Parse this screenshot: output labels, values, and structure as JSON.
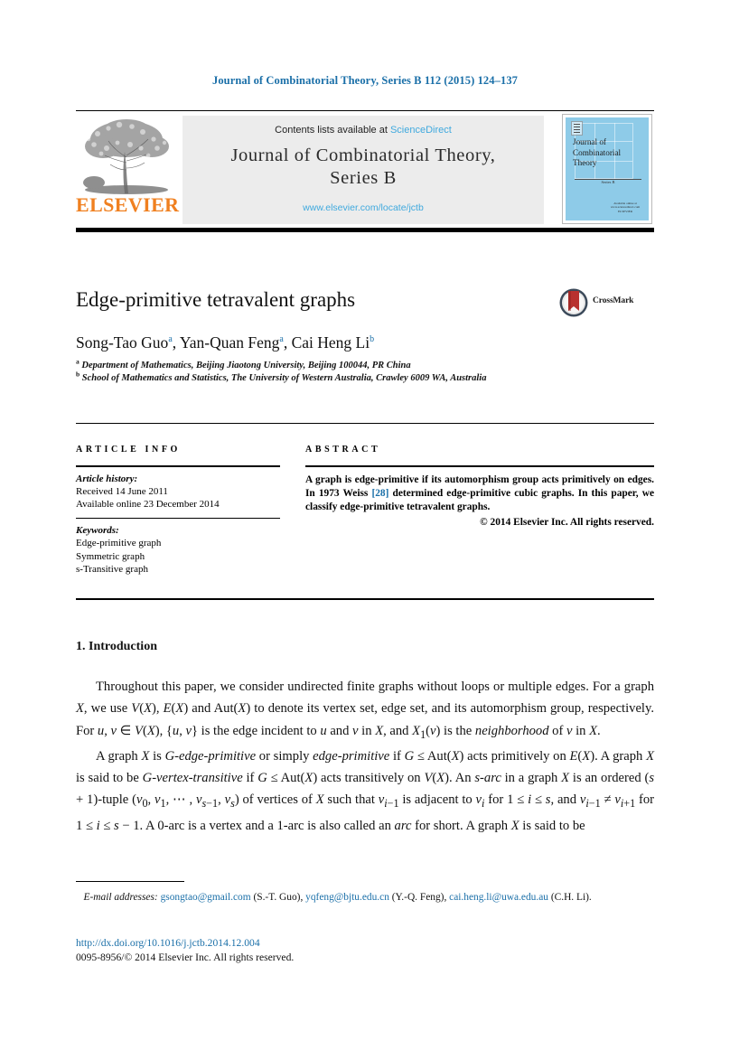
{
  "running_head": "Journal of Combinatorial Theory, Series B 112 (2015) 124–137",
  "masthead": {
    "contents_prefix": "Contents lists available at ",
    "sciencedirect": "ScienceDirect",
    "journal_title": "Journal of Combinatorial Theory,",
    "journal_subtitle": "Series B",
    "journal_url": "www.elsevier.com/locate/jctb",
    "publisher_wordmark": "ELSEVIER",
    "publisher_logo_alt": "elsevier-tree-logo",
    "cover": {
      "title_line1": "Journal of",
      "title_line2": "Combinatorial",
      "title_line3": "Theory",
      "volume_label": "Series B",
      "footer_line1": "ELSEVIER",
      "footer_line2": "Available online at www.sciencedirect.com"
    }
  },
  "article": {
    "title": "Edge-primitive tetravalent graphs",
    "crossmark_label": "CrossMark",
    "authors": [
      {
        "name": "Song-Tao Guo",
        "affil": "a",
        "sep": ", "
      },
      {
        "name": "Yan-Quan Feng",
        "affil": "a",
        "sep": ", "
      },
      {
        "name": "Cai Heng Li",
        "affil": "b",
        "sep": ""
      }
    ],
    "affiliations": [
      {
        "marker": "a",
        "text": "Department of Mathematics, Beijing Jiaotong University, Beijing 100044, PR China"
      },
      {
        "marker": "b",
        "text": "School of Mathematics and Statistics, The University of Western Australia, Crawley 6009 WA, Australia"
      }
    ]
  },
  "info": {
    "heading": "ARTICLE INFO",
    "history_label": "Article history:",
    "history": [
      "Received 14 June 2011",
      "Available online 23 December 2014"
    ],
    "keywords_label": "Keywords:",
    "keywords": [
      "Edge-primitive graph",
      "Symmetric graph",
      "s-Transitive graph"
    ]
  },
  "abstract": {
    "heading": "ABSTRACT",
    "text_part1": "A graph is edge-primitive if its automorphism group acts primitively on edges. In 1973 Weiss ",
    "reference": "[28]",
    "text_part2": " determined edge-primitive cubic graphs. In this paper, we classify edge-primitive tetravalent graphs.",
    "copyright": "© 2014 Elsevier Inc. All rights reserved."
  },
  "body": {
    "section_number_title": "1.  Introduction",
    "paragraph1_a": "Throughout this paper, we consider undirected finite graphs without loops or multiple edges. For a graph ",
    "paragraph1_b": ", we use ",
    "paragraph1_c": " and ",
    "paragraph1_d": " to denote its vertex set, edge set, and its automorphism group, respectively. For ",
    "paragraph1_e": " is the edge incident to ",
    "paragraph1_f": " and ",
    "paragraph1_g": " in ",
    "paragraph1_h": ", and ",
    "paragraph1_i": " is the ",
    "paragraph1_j": "neighborhood",
    "paragraph1_k": " of ",
    "paragraph1_l": " in ",
    "paragraph1_m": ".",
    "paragraph2_a": "A graph ",
    "paragraph2_b": " is ",
    "paragraph2_c": "G-edge-primitive",
    "paragraph2_d": " or simply ",
    "paragraph2_e": "edge-primitive",
    "paragraph2_f": " if ",
    "paragraph2_g": " acts primitively on ",
    "paragraph2_h": ". A graph ",
    "paragraph2_i": " is said to be ",
    "paragraph2_j": "G-vertex-transitive",
    "paragraph2_k": " acts transitively on ",
    "paragraph2_l": ". An ",
    "paragraph2_m": "s-arc",
    "paragraph2_n": " in a graph ",
    "paragraph2_o": " is an ordered ",
    "paragraph2_p": "-tuple ",
    "paragraph2_q": " of vertices of ",
    "paragraph2_r": " such that ",
    "paragraph2_s": " is adjacent to ",
    "paragraph2_t": " for ",
    "paragraph2_u": ", and ",
    "paragraph2_v": " for ",
    "paragraph2_w": ". A 0-arc is a vertex and a 1-arc is also called an ",
    "paragraph2_x": "arc",
    "paragraph2_y": " for short. A graph ",
    "paragraph2_z": " is said to be"
  },
  "footer": {
    "email_label": "E-mail addresses:",
    "emails": [
      {
        "address": "gsongtao@gmail.com",
        "owner": "(S.-T. Guo)",
        "sep": ", "
      },
      {
        "address": "yqfeng@bjtu.edu.cn",
        "owner": "(Y.-Q. Feng)",
        "sep": ","
      },
      {
        "address": "cai.heng.li@uwa.edu.au",
        "owner": "(C.H. Li).",
        "sep": ""
      }
    ],
    "doi": "http://dx.doi.org/10.1016/j.jctb.2014.12.004",
    "issn_copyright": "0095-8956/© 2014 Elsevier Inc. All rights reserved."
  },
  "colors": {
    "link_blue": "#1a6fa8",
    "sciencedirect_blue": "#3fa9de",
    "elsevier_orange": "#f08020",
    "cover_blue": "#8ecbe8",
    "crossmark_red": "#b8312f"
  }
}
